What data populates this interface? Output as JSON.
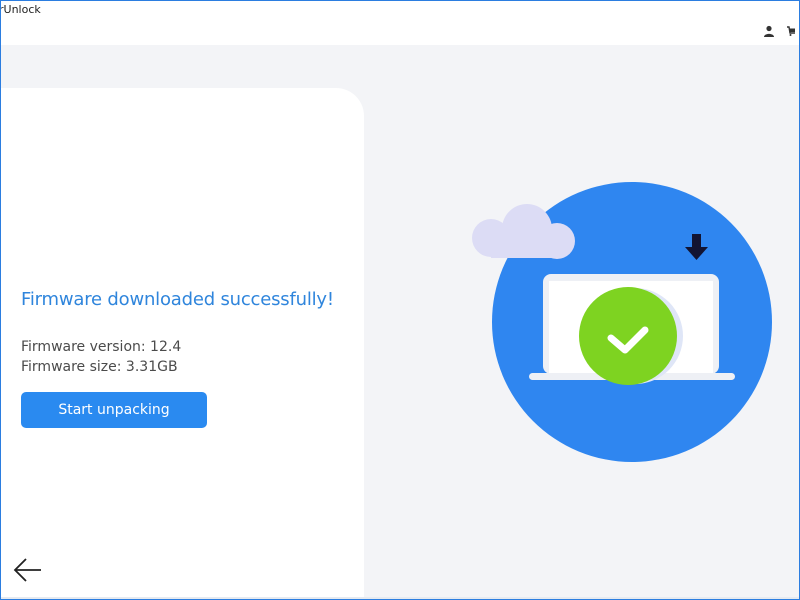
{
  "window": {
    "title": "rUnlock"
  },
  "titlebar": {
    "account_icon": "user-icon",
    "cart_icon": "cart-icon"
  },
  "main": {
    "headline": "Firmware downloaded successfully!",
    "firmware_version": "Firmware version: 12.4",
    "firmware_size": "Firmware size: 3.31GB",
    "primary_button": "Start unpacking"
  },
  "navigation": {
    "back_icon": "arrow-left-icon"
  },
  "illustration": {
    "icons": [
      "cloud-icon",
      "download-arrow-icon",
      "laptop-icon",
      "checkmark-icon"
    ]
  },
  "colors": {
    "accent": "#2a8af0",
    "headline": "#2f85dc",
    "illustration_circle": "#2f86f0",
    "success": "#7ed321",
    "cloud": "#dcdcf5"
  }
}
